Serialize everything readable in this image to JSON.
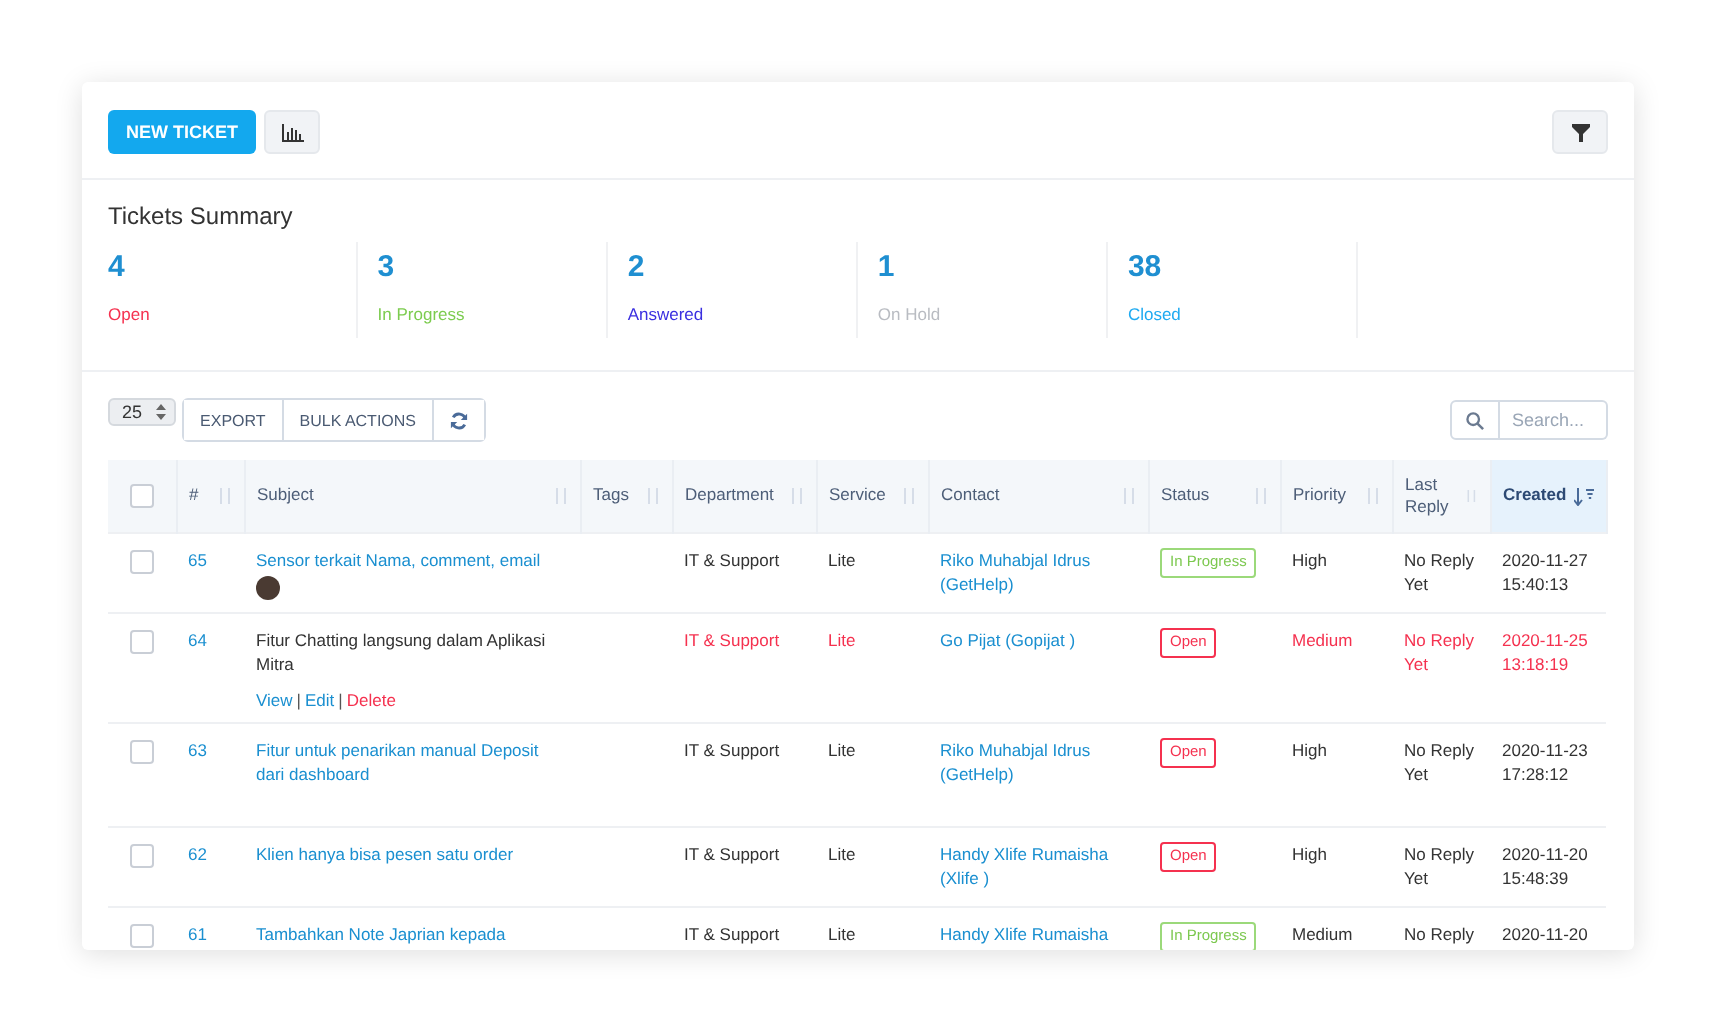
{
  "toolbar": {
    "new_button": "NEW TICKET"
  },
  "summary": {
    "title": "Tickets Summary",
    "stats": [
      {
        "value": "4",
        "label": "Open",
        "color": "#f5314f"
      },
      {
        "value": "3",
        "label": "In Progress",
        "color": "#7ccc4f"
      },
      {
        "value": "2",
        "label": "Answered",
        "color": "#3a2fe0"
      },
      {
        "value": "1",
        "label": "On Hold",
        "color": "#b9bcc2"
      },
      {
        "value": "38",
        "label": "Closed",
        "color": "#1eaaf1"
      }
    ]
  },
  "controls": {
    "page_size": "25",
    "buttons": [
      "EXPORT",
      "BULK ACTIONS"
    ],
    "search": {
      "placeholder": "Search..."
    }
  },
  "table": {
    "select_all": {
      "checked": false
    },
    "columns": [
      {
        "label": "#",
        "sorted": false
      },
      {
        "label": "Subject",
        "sorted": false
      },
      {
        "label": "Tags",
        "sorted": false
      },
      {
        "label": "Department",
        "sorted": false
      },
      {
        "label": "Service",
        "sorted": false
      },
      {
        "label": "Contact",
        "sorted": false
      },
      {
        "label": "Status",
        "sorted": false
      },
      {
        "label": "Priority",
        "sorted": false
      },
      {
        "label": "Last Reply",
        "sorted": false
      },
      {
        "label": "Created",
        "sorted": true
      }
    ],
    "rows": [
      {
        "checked": false,
        "id": "65",
        "subject": "Sensor terkait Nama, comment, email",
        "avatar": true,
        "hovered": false,
        "overdue": false,
        "department": "IT & Support",
        "service": "Lite",
        "contact": "Riko Muhabjal Idrus (GetHelp)",
        "status": {
          "label": "In Progress",
          "kind": "progress"
        },
        "priority": "High",
        "last_reply": "No Reply Yet",
        "created": "2020-11-27 15:40:13"
      },
      {
        "checked": false,
        "id": "64",
        "subject": "Fitur Chatting langsung dalam Aplikasi Mitra",
        "hovered": true,
        "action_separator": "|",
        "actions": [
          {
            "label": "View",
            "kind": "link"
          },
          {
            "label": "Edit",
            "kind": "link"
          },
          {
            "label": "Delete",
            "kind": "danger"
          }
        ],
        "overdue": true,
        "department": "IT & Support",
        "service": "Lite",
        "contact": "Go Pijat (Gopijat )",
        "status": {
          "label": "Open",
          "kind": "open"
        },
        "priority": "Medium",
        "last_reply": "No Reply Yet",
        "created": "2020-11-25 13:18:19"
      },
      {
        "checked": false,
        "id": "63",
        "subject": "Fitur untuk penarikan manual Deposit dari dashboard",
        "hovered": false,
        "overdue": false,
        "department": "IT & Support",
        "service": "Lite",
        "contact": "Riko Muhabjal Idrus (GetHelp)",
        "status": {
          "label": "Open",
          "kind": "open"
        },
        "priority": "High",
        "last_reply": "No Reply Yet",
        "created": "2020-11-23 17:28:12"
      },
      {
        "checked": false,
        "id": "62",
        "subject": "Klien hanya bisa pesen satu order",
        "hovered": false,
        "overdue": false,
        "department": "IT & Support",
        "service": "Lite",
        "contact": "Handy Xlife Rumaisha (Xlife )",
        "status": {
          "label": "Open",
          "kind": "open"
        },
        "priority": "High",
        "last_reply": "No Reply Yet",
        "created": "2020-11-20 15:48:39"
      },
      {
        "checked": false,
        "id": "61",
        "subject": "Tambahkan Note Japrian kepada",
        "hovered": false,
        "overdue": false,
        "department": "IT & Support",
        "service": "Lite",
        "contact": "Handy Xlife Rumaisha",
        "status": {
          "label": "In Progress",
          "kind": "progress"
        },
        "priority": "Medium",
        "last_reply": "No Reply",
        "created": "2020-11-20"
      }
    ]
  }
}
